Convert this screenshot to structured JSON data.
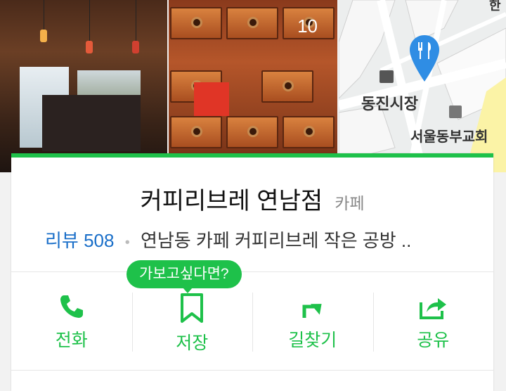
{
  "photos": {
    "count": "10"
  },
  "map": {
    "market_label": "동진시장",
    "church_label": "서울동부교회",
    "top_label": "한"
  },
  "place": {
    "name": "커피리브레 연남점",
    "category": "카페",
    "review_label": "리뷰 508",
    "description": "연남동 카페 커피리브레 작은 공방 .."
  },
  "tooltip": "가보고싶다면?",
  "actions": [
    {
      "label": "전화",
      "icon": "phone-icon"
    },
    {
      "label": "저장",
      "icon": "bookmark-icon"
    },
    {
      "label": "길찾기",
      "icon": "directions-icon"
    },
    {
      "label": "공유",
      "icon": "share-icon"
    }
  ],
  "colors": {
    "accent": "#1ec14a",
    "link": "#1a6fc9",
    "pin": "#2f8de4"
  }
}
